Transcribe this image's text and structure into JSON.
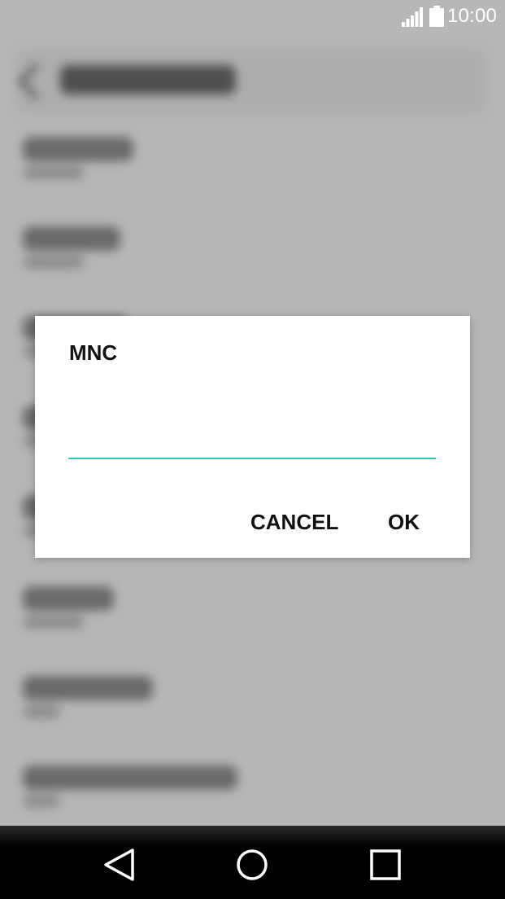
{
  "status_bar": {
    "time": "10:00",
    "signal_icon": "signal-icon",
    "battery_icon": "battery-icon"
  },
  "dialog": {
    "title": "MNC",
    "input_value": "",
    "cancel_label": "CANCEL",
    "ok_label": "OK",
    "accent_color": "#2cc7bd"
  },
  "nav_bar": {
    "back_icon": "back-icon",
    "home_icon": "home-icon",
    "recents_icon": "recents-icon"
  }
}
